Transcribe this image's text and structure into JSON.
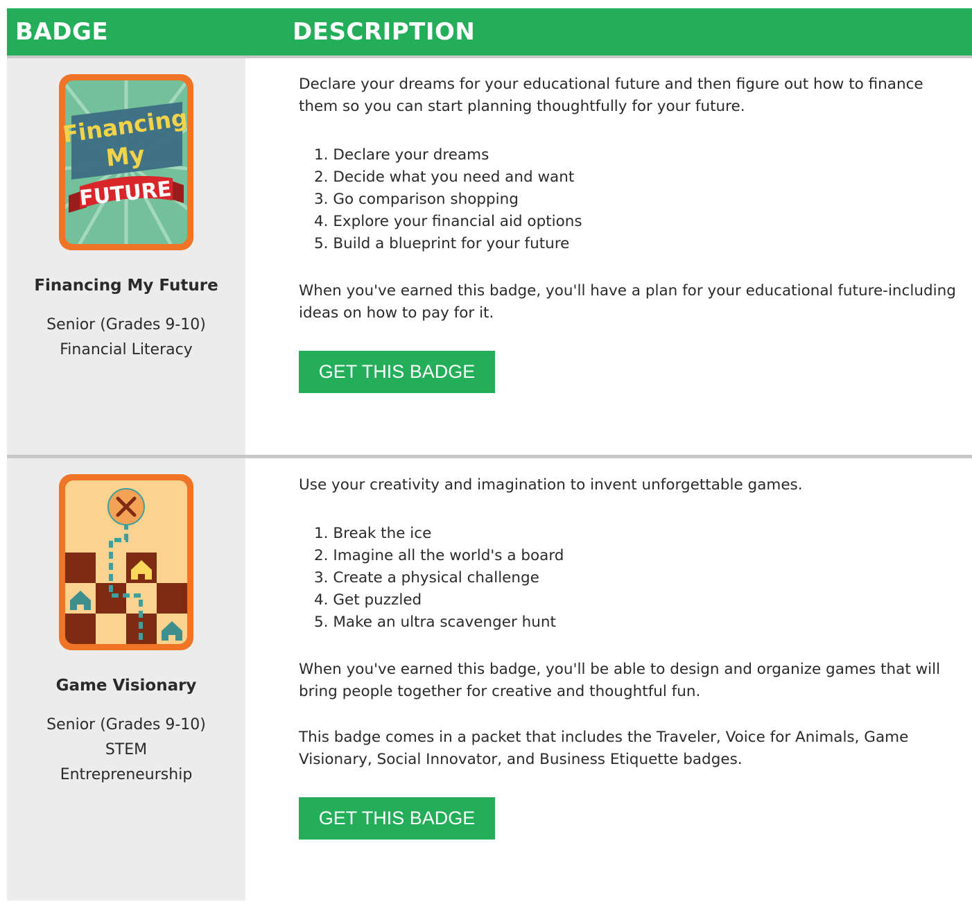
{
  "table": {
    "headers": {
      "badge": "BADGE",
      "description": "DESCRIPTION"
    },
    "rows": [
      {
        "badge_name": "Financing My Future",
        "badge_art_text": [
          "Financing",
          "My",
          "FUTURE"
        ],
        "meta": [
          "Senior (Grades 9-10)",
          "Financial Literacy"
        ],
        "intro": "Declare your dreams for your educational future and then figure out how to finance them so you can start planning thoughtfully for your future.",
        "steps": [
          "1. Declare your dreams",
          "2. Decide what you need and want",
          "3. Go comparison shopping",
          "4. Explore your financial aid options",
          "5. Build a blueprint for your future"
        ],
        "outcome": "When you've earned this badge, you'll have a plan for your educational future-including ideas on how to pay for it.",
        "button": "GET THIS BADGE"
      },
      {
        "badge_name": "Game Visionary",
        "meta": [
          "Senior (Grades 9-10)",
          "STEM",
          "Entrepreneurship"
        ],
        "intro": "Use your creativity and imagination to invent unforgettable games.",
        "steps": [
          "1. Break the ice",
          "2. Imagine all the world's a board",
          "3. Create a physical challenge",
          "4. Get puzzled",
          "5. Make an ultra scavenger hunt"
        ],
        "outcome": "When you've earned this badge, you'll be able to design and organize games that will bring people together for creative and thoughtful fun.",
        "note": "This badge comes in a packet that includes the Traveler, Voice for Animals, Game Visionary, Social Innovator, and Business Etiquette badges.",
        "button": "GET THIS BADGE"
      }
    ]
  },
  "colors": {
    "header_green": "#24ae5a",
    "button_green": "#24ae5a",
    "left_column_bg": "#ececec",
    "divider": "#c7c7c7",
    "badge_border_orange": "#f07425"
  }
}
